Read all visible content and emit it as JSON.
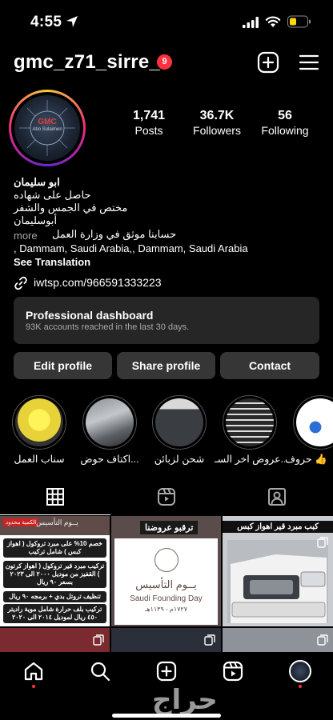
{
  "status_bar": {
    "time": "4:55"
  },
  "profile": {
    "username": "gmc_z71_sirre_",
    "notification_count": "9",
    "avatar": {
      "logo_text": "GMC",
      "caption": "Abo Sulaimen"
    },
    "stats": {
      "posts": {
        "value": "1,741",
        "label": "Posts"
      },
      "followers": {
        "value": "36.7K",
        "label": "Followers"
      },
      "following": {
        "value": "56",
        "label": "Following"
      }
    },
    "bio": {
      "name": "ابو سليمان",
      "line1": "حاصل على شهاده",
      "line2": "مختص في الجمس والشفر",
      "line3": "أبوسليمان",
      "more": "more",
      "line4": "حسابنا موثق في وزارة العمل",
      "location": ", Dammam, Saudi Arabia,, Dammam, Saudi Arabia",
      "see_translation": "See Translation"
    },
    "link": "iwtsp.com/966591333223"
  },
  "dashboard": {
    "title": "Professional dashboard",
    "subtitle": "93K accounts reached in the last 30 days."
  },
  "actions": {
    "edit": "Edit profile",
    "share": "Share profile",
    "contact": "Contact"
  },
  "highlights": [
    {
      "label": "سناب العمل"
    },
    {
      "label": "اكتاف حوض..."
    },
    {
      "label": "شحن لزبائن"
    },
    {
      "label": "عروض اخر السـ..."
    },
    {
      "label": "حروف 👍"
    }
  ],
  "tabs": [
    "grid-icon",
    "reels-icon",
    "tagged-icon"
  ],
  "grid": {
    "tile1": {
      "tag": "الكمية محدود",
      "brand": "يــوم التأسيس",
      "lines": [
        "خصم 10% على مبرد تروكول ( اهواز كبس ) شامل تركيب",
        "تركيب مبرد قير تروكول ( اهواز كرتون ) القفيز من موديل ٢٠٠٠ الى ٢٠٢٣ بسعر ٩٠ ريال",
        "تنظيف تروتل بدي + برمجه ٩٠ ريال",
        "تركيب بلف حرارة شامل موية راديتر ٤٥٠ ريال لموديل ٢٠١٤ الى ٢٠٢٠"
      ]
    },
    "tile2": {
      "tag": "ترقبو عروضنا",
      "title_ar": "يــوم التأسيس",
      "title_en": "Saudi Founding Day",
      "year": "١٧٢٧م - ١١٣٩هـ"
    },
    "tile3": {
      "header": "كبب مبرد قير اهواز كبس"
    }
  },
  "watermark": "حراج",
  "colors": {
    "accent_red": "#ff3040",
    "button_bg": "#363636",
    "card_bg": "#262626"
  }
}
